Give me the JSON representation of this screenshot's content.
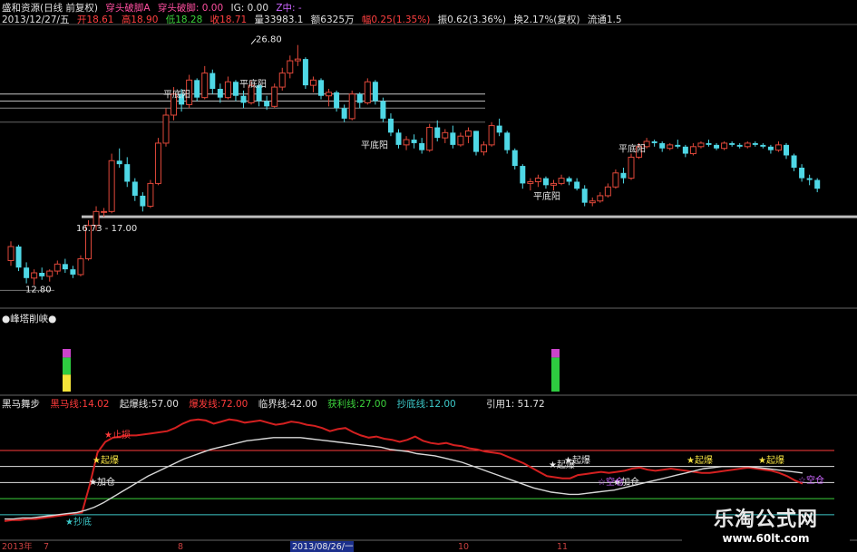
{
  "header": {
    "title": "盛和资源(日线 前复权)",
    "indicator": "穿头破脚A",
    "ind_val1": "穿头破脚: 0.00",
    "ind_val2": "IG: 0.00",
    "ind_val3": "Z中: -",
    "date": "2013/12/27/五",
    "open": "开18.61",
    "high": "高18.90",
    "low": "低18.28",
    "close": "收18.71",
    "volume": "量33983.1",
    "amount": "额6325万",
    "change": "幅0.25(1.35%)",
    "amplitude": "振0.62(3.36%)",
    "turnover": "换2.17%(复权)",
    "float": "流通1.5"
  },
  "panel2": {
    "title": "●峰塔削峡●"
  },
  "panel3": {
    "title": "黑马舞步",
    "items": [
      {
        "label": "黑马线:",
        "value": "14.02",
        "color": "#ff3b3b"
      },
      {
        "label": "起爆线:",
        "value": "57.00",
        "color": "#e0e0e0"
      },
      {
        "label": "爆发线:",
        "value": "72.00",
        "color": "#ff3b3b"
      },
      {
        "label": "临界线:",
        "value": "42.00",
        "color": "#e0e0e0"
      },
      {
        "label": "获利线:",
        "value": "27.00",
        "color": "#3cd23c"
      },
      {
        "label": "抄底线:",
        "value": "12.00",
        "color": "#3cc8c8"
      }
    ],
    "ref": "引用1: 51.72"
  },
  "xaxis": {
    "labels": [
      "2013年",
      "7",
      "8",
      "2013/08/26/一",
      "10",
      "11"
    ]
  },
  "watermark": {
    "title": "乐淘公式网",
    "url": "www.60lt.com"
  },
  "chart_data": [
    {
      "type": "candlestick",
      "title": "盛和资源(日线 前复权)",
      "annotations": [
        {
          "text": "26.80",
          "kind": "high"
        },
        {
          "text": "16.73 - 17.00",
          "kind": "level"
        },
        {
          "text": "12.80",
          "kind": "low"
        },
        {
          "text": "平底阳",
          "kind": "pattern"
        },
        {
          "text": "平底阳",
          "kind": "pattern"
        },
        {
          "text": "平底阳",
          "kind": "pattern"
        },
        {
          "text": "平底阳",
          "kind": "pattern"
        },
        {
          "text": "平底阳",
          "kind": "pattern"
        }
      ],
      "candles": [
        [
          14.5,
          15.6,
          14.2,
          15.3
        ],
        [
          15.3,
          15.4,
          13.9,
          14.1
        ],
        [
          14.1,
          14.4,
          13.2,
          13.5
        ],
        [
          13.5,
          14.0,
          13.1,
          13.8
        ],
        [
          13.8,
          14.1,
          13.4,
          13.6
        ],
        [
          13.6,
          14.0,
          13.3,
          13.9
        ],
        [
          13.9,
          14.5,
          13.7,
          14.3
        ],
        [
          14.3,
          14.6,
          13.8,
          14.0
        ],
        [
          14.0,
          14.2,
          13.5,
          13.7
        ],
        [
          13.7,
          14.8,
          13.6,
          14.6
        ],
        [
          14.6,
          16.8,
          14.5,
          16.5
        ],
        [
          16.5,
          17.6,
          16.2,
          17.3
        ],
        [
          17.3,
          17.5,
          17.0,
          17.3
        ],
        [
          17.3,
          20.6,
          17.2,
          20.2
        ],
        [
          20.2,
          20.9,
          19.8,
          20.0
        ],
        [
          20.0,
          20.4,
          18.7,
          19.0
        ],
        [
          19.0,
          19.2,
          17.9,
          18.2
        ],
        [
          18.2,
          18.4,
          17.3,
          17.6
        ],
        [
          17.6,
          19.1,
          17.5,
          18.9
        ],
        [
          18.9,
          21.5,
          18.8,
          21.2
        ],
        [
          21.2,
          23.2,
          21.0,
          22.8
        ],
        [
          22.8,
          24.4,
          22.5,
          24.0
        ],
        [
          24.0,
          24.3,
          23.0,
          23.4
        ],
        [
          23.4,
          25.1,
          23.2,
          24.8
        ],
        [
          24.8,
          24.9,
          23.6,
          23.8
        ],
        [
          23.8,
          25.6,
          23.7,
          25.2
        ],
        [
          25.2,
          25.4,
          24.0,
          24.3
        ],
        [
          24.3,
          24.6,
          23.5,
          23.8
        ],
        [
          23.8,
          25.0,
          23.7,
          24.7
        ],
        [
          24.7,
          24.8,
          23.6,
          23.9
        ],
        [
          23.9,
          24.2,
          23.2,
          23.5
        ],
        [
          23.5,
          24.8,
          23.4,
          24.5
        ],
        [
          24.5,
          24.6,
          23.3,
          23.6
        ],
        [
          23.6,
          23.9,
          23.1,
          23.3
        ],
        [
          23.3,
          24.6,
          23.2,
          24.4
        ],
        [
          24.4,
          25.5,
          24.2,
          25.2
        ],
        [
          25.2,
          26.2,
          24.9,
          25.9
        ],
        [
          25.9,
          26.8,
          25.6,
          26.0
        ],
        [
          26.0,
          26.1,
          24.3,
          24.5
        ],
        [
          24.5,
          25.0,
          24.1,
          24.8
        ],
        [
          24.8,
          24.9,
          23.7,
          23.9
        ],
        [
          23.9,
          24.3,
          23.3,
          24.1
        ],
        [
          24.1,
          24.2,
          23.0,
          23.2
        ],
        [
          23.2,
          23.4,
          22.4,
          22.6
        ],
        [
          22.6,
          24.2,
          22.5,
          24.0
        ],
        [
          24.0,
          24.1,
          23.2,
          23.5
        ],
        [
          23.5,
          24.9,
          23.4,
          24.7
        ],
        [
          24.7,
          24.8,
          23.4,
          23.6
        ],
        [
          23.6,
          23.8,
          22.4,
          22.6
        ],
        [
          22.6,
          22.9,
          21.6,
          21.8
        ],
        [
          21.8,
          22.0,
          20.9,
          21.1
        ],
        [
          21.1,
          21.6,
          20.8,
          21.4
        ],
        [
          21.4,
          21.7,
          20.9,
          21.2
        ],
        [
          21.2,
          21.5,
          20.6,
          20.8
        ],
        [
          20.8,
          22.3,
          20.7,
          22.1
        ],
        [
          22.1,
          22.5,
          21.3,
          21.5
        ],
        [
          21.5,
          22.0,
          21.2,
          21.8
        ],
        [
          21.8,
          22.2,
          20.9,
          21.1
        ],
        [
          21.1,
          21.8,
          21.0,
          21.6
        ],
        [
          21.6,
          22.1,
          21.2,
          21.9
        ],
        [
          21.9,
          21.9,
          20.5,
          20.7
        ],
        [
          20.7,
          21.3,
          20.5,
          21.1
        ],
        [
          21.1,
          22.4,
          21.0,
          22.2
        ],
        [
          22.2,
          22.6,
          21.6,
          21.8
        ],
        [
          21.8,
          21.9,
          20.6,
          20.8
        ],
        [
          20.8,
          20.9,
          19.7,
          19.9
        ],
        [
          19.9,
          20.0,
          18.6,
          18.9
        ],
        [
          18.9,
          19.2,
          18.5,
          19.0
        ],
        [
          19.0,
          19.4,
          18.7,
          19.2
        ],
        [
          19.2,
          19.3,
          18.6,
          18.8
        ],
        [
          18.8,
          19.1,
          18.5,
          18.9
        ],
        [
          18.9,
          19.4,
          18.8,
          19.2
        ],
        [
          19.2,
          19.3,
          18.8,
          19.0
        ],
        [
          19.0,
          19.2,
          18.5,
          18.6
        ],
        [
          18.6,
          18.8,
          17.6,
          17.8
        ],
        [
          17.8,
          18.1,
          17.6,
          17.9
        ],
        [
          17.9,
          18.4,
          17.8,
          18.2
        ],
        [
          18.2,
          18.9,
          18.1,
          18.7
        ],
        [
          18.7,
          19.7,
          18.6,
          19.5
        ],
        [
          19.5,
          19.8,
          18.9,
          19.2
        ],
        [
          19.2,
          20.6,
          19.1,
          20.4
        ],
        [
          20.4,
          21.2,
          20.3,
          21.0
        ],
        [
          21.0,
          21.5,
          20.9,
          21.3
        ],
        [
          21.3,
          21.4,
          21.0,
          21.2
        ],
        [
          21.2,
          21.3,
          20.7,
          20.9
        ],
        [
          20.9,
          21.2,
          20.8,
          21.1
        ],
        [
          21.1,
          21.4,
          20.9,
          21.0
        ],
        [
          21.0,
          21.1,
          20.4,
          20.6
        ],
        [
          20.6,
          21.2,
          20.5,
          21.0
        ],
        [
          21.0,
          21.3,
          20.9,
          21.2
        ],
        [
          21.2,
          21.4,
          21.0,
          21.1
        ],
        [
          21.1,
          21.2,
          20.8,
          20.9
        ],
        [
          20.9,
          21.3,
          20.8,
          21.2
        ],
        [
          21.2,
          21.3,
          21.0,
          21.1
        ],
        [
          21.1,
          21.2,
          20.9,
          21.0
        ],
        [
          21.0,
          21.3,
          20.9,
          21.2
        ],
        [
          21.2,
          21.3,
          21.0,
          21.1
        ],
        [
          21.1,
          21.2,
          20.9,
          21.0
        ],
        [
          21.0,
          21.1,
          20.6,
          20.8
        ],
        [
          20.8,
          21.3,
          20.7,
          21.1
        ],
        [
          21.1,
          21.2,
          20.3,
          20.5
        ],
        [
          20.5,
          20.6,
          19.6,
          19.8
        ],
        [
          19.8,
          20.0,
          19.0,
          19.2
        ],
        [
          19.2,
          19.4,
          18.8,
          19.1
        ],
        [
          19.1,
          19.2,
          18.4,
          18.6
        ]
      ]
    },
    {
      "type": "bar",
      "title": "●峰塔削峡●",
      "signals": [
        {
          "segments": [
            {
              "color": "#cc44cc",
              "value": 1
            },
            {
              "color": "#2ecc40",
              "value": 2
            },
            {
              "color": "#f3e43a",
              "value": 2
            }
          ]
        },
        {
          "segments": [
            {
              "color": "#cc44cc",
              "value": 1
            },
            {
              "color": "#2ecc40",
              "value": 4
            }
          ]
        }
      ]
    },
    {
      "type": "line",
      "title": "黑马舞步",
      "levels": [
        {
          "name": "爆发线",
          "value": 72,
          "color": "#ff3b3b"
        },
        {
          "name": "起爆线",
          "value": 57,
          "color": "#e0e0e0"
        },
        {
          "name": "临界线",
          "value": 42,
          "color": "#e0e0e0"
        },
        {
          "name": "获利线",
          "value": 27,
          "color": "#3cd23c"
        },
        {
          "name": "抄底线",
          "value": 12,
          "color": "#3cc8c8"
        }
      ],
      "series": [
        {
          "name": "黑马线",
          "color": "#d42020",
          "values": [
            6,
            7,
            7,
            8,
            8,
            9,
            10,
            11,
            12,
            13,
            14,
            40,
            70,
            80,
            84,
            85,
            86,
            86,
            87,
            88,
            89,
            90,
            93,
            97,
            100,
            101,
            100,
            97,
            99,
            101,
            100,
            98,
            99,
            100,
            98,
            96,
            97,
            99,
            98,
            96,
            95,
            93,
            90,
            92,
            93,
            89,
            86,
            84,
            85,
            83,
            82,
            80,
            82,
            85,
            81,
            79,
            78,
            79,
            77,
            76,
            74,
            73,
            71,
            70,
            69,
            66,
            63,
            60,
            56,
            52,
            48,
            47,
            46,
            46,
            49,
            50,
            51,
            52,
            51,
            52,
            53,
            55,
            56,
            54,
            53,
            54,
            55,
            54,
            53,
            52,
            51,
            51,
            52,
            53,
            54,
            55,
            56,
            55,
            54,
            53,
            51,
            48,
            44,
            41
          ]
        },
        {
          "name": "白线",
          "color": "#d8d8d8",
          "values": [
            8,
            8,
            9,
            9,
            10,
            11,
            12,
            13,
            14,
            16,
            19,
            23,
            28,
            33,
            38,
            43,
            48,
            52,
            56,
            60,
            64,
            67,
            70,
            73,
            75,
            77,
            79,
            81,
            82,
            83,
            84,
            84,
            84,
            84,
            83,
            82,
            81,
            80,
            79,
            78,
            77,
            76,
            75,
            73,
            72,
            71,
            69,
            68,
            67,
            65,
            63,
            61,
            58,
            55,
            52,
            49,
            46,
            43,
            40,
            37,
            35,
            33,
            32,
            31,
            31,
            32,
            33,
            34,
            35,
            37,
            39,
            41,
            43,
            45,
            47,
            49,
            51,
            53,
            55,
            56,
            57,
            57,
            57,
            57,
            56,
            55,
            54,
            53,
            52,
            51
          ]
        }
      ],
      "annotations": [
        "★起爆",
        "★加仓",
        "★起爆",
        "★加仓",
        "★起爆",
        "★起爆",
        "☆空仓",
        "☆空仓",
        "★起爆",
        "★止损",
        "★抄底"
      ]
    }
  ]
}
